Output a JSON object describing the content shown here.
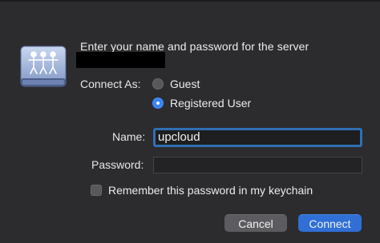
{
  "dialog": {
    "message": "Enter your name and password for the server",
    "server_icon": "network-server-icon",
    "connect_as": {
      "label": "Connect As:",
      "options": [
        {
          "label": "Guest",
          "selected": false
        },
        {
          "label": "Registered User",
          "selected": true
        }
      ]
    },
    "name": {
      "label": "Name:",
      "value": "upcloud"
    },
    "password": {
      "label": "Password:",
      "value": ""
    },
    "remember": {
      "label": "Remember this password in my keychain",
      "checked": false
    },
    "buttons": {
      "cancel": "Cancel",
      "connect": "Connect"
    },
    "colors": {
      "accent": "#2f6fd6",
      "background": "#2c2b2e",
      "focus_ring": "#2f6fb3"
    }
  }
}
